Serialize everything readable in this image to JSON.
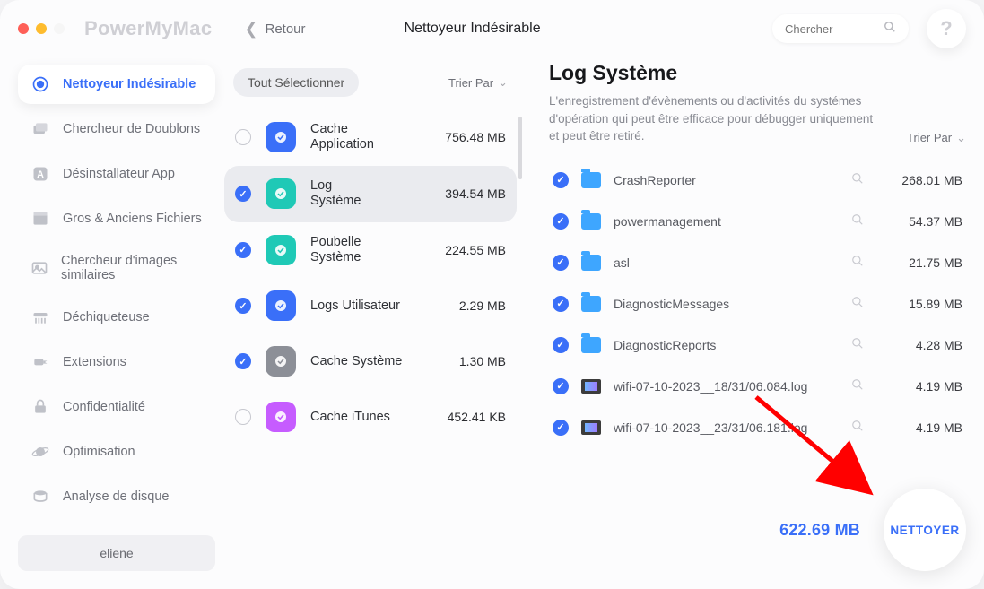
{
  "app": {
    "name": "PowerMyMac",
    "back": "Retour",
    "page_title": "Nettoyeur Indésirable",
    "search_placeholder": "Chercher",
    "help": "?"
  },
  "sidebar": {
    "items": [
      {
        "label": "Nettoyeur Indésirable"
      },
      {
        "label": "Chercheur de Doublons"
      },
      {
        "label": "Désinstallateur App"
      },
      {
        "label": "Gros & Anciens Fichiers"
      },
      {
        "label": "Chercheur d'images similaires"
      },
      {
        "label": "Déchiqueteuse"
      },
      {
        "label": "Extensions"
      },
      {
        "label": "Confidentialité"
      },
      {
        "label": "Optimisation"
      },
      {
        "label": "Analyse de disque"
      }
    ],
    "user": "eliene"
  },
  "mid": {
    "select_all": "Tout Sélectionner",
    "sort": "Trier Par",
    "categories": [
      {
        "name": "Cache Application",
        "size": "756.48 MB",
        "checked": false,
        "iconColor": "#3a6ff8"
      },
      {
        "name": "Log Système",
        "size": "394.54 MB",
        "checked": true,
        "iconColor": "#1fc9b6",
        "selected": true
      },
      {
        "name": "Poubelle Système",
        "size": "224.55 MB",
        "checked": true,
        "iconColor": "#1fc9b6"
      },
      {
        "name": "Logs Utilisateur",
        "size": "2.29 MB",
        "checked": true,
        "iconColor": "#3a6ff8"
      },
      {
        "name": "Cache Système",
        "size": "1.30 MB",
        "checked": true,
        "iconColor": "#8c8f97"
      },
      {
        "name": "Cache iTunes",
        "size": "452.41 KB",
        "checked": false,
        "iconColor": "#c65cff"
      }
    ]
  },
  "detail": {
    "title": "Log Système",
    "desc": "L'enregistrement  d'évènements  ou d'activités du systémes d'opération qui peut être efficace pour débugger uniquement et peut être retiré.",
    "sort": "Trier Par",
    "files": [
      {
        "name": "CrashReporter",
        "size": "268.01 MB",
        "kind": "folder",
        "checked": true
      },
      {
        "name": "powermanagement",
        "size": "54.37 MB",
        "kind": "folder",
        "checked": true
      },
      {
        "name": "asl",
        "size": "21.75 MB",
        "kind": "folder",
        "checked": true
      },
      {
        "name": "DiagnosticMessages",
        "size": "15.89 MB",
        "kind": "folder",
        "checked": true
      },
      {
        "name": "DiagnosticReports",
        "size": "4.28 MB",
        "kind": "folder",
        "checked": true
      },
      {
        "name": "wifi-07-10-2023__18/31/06.084.log",
        "size": "4.19 MB",
        "kind": "file",
        "checked": true
      },
      {
        "name": "wifi-07-10-2023__23/31/06.181.log",
        "size": "4.19 MB",
        "kind": "file",
        "checked": true
      }
    ],
    "total": "622.69 MB",
    "clean": "NETTOYER"
  }
}
